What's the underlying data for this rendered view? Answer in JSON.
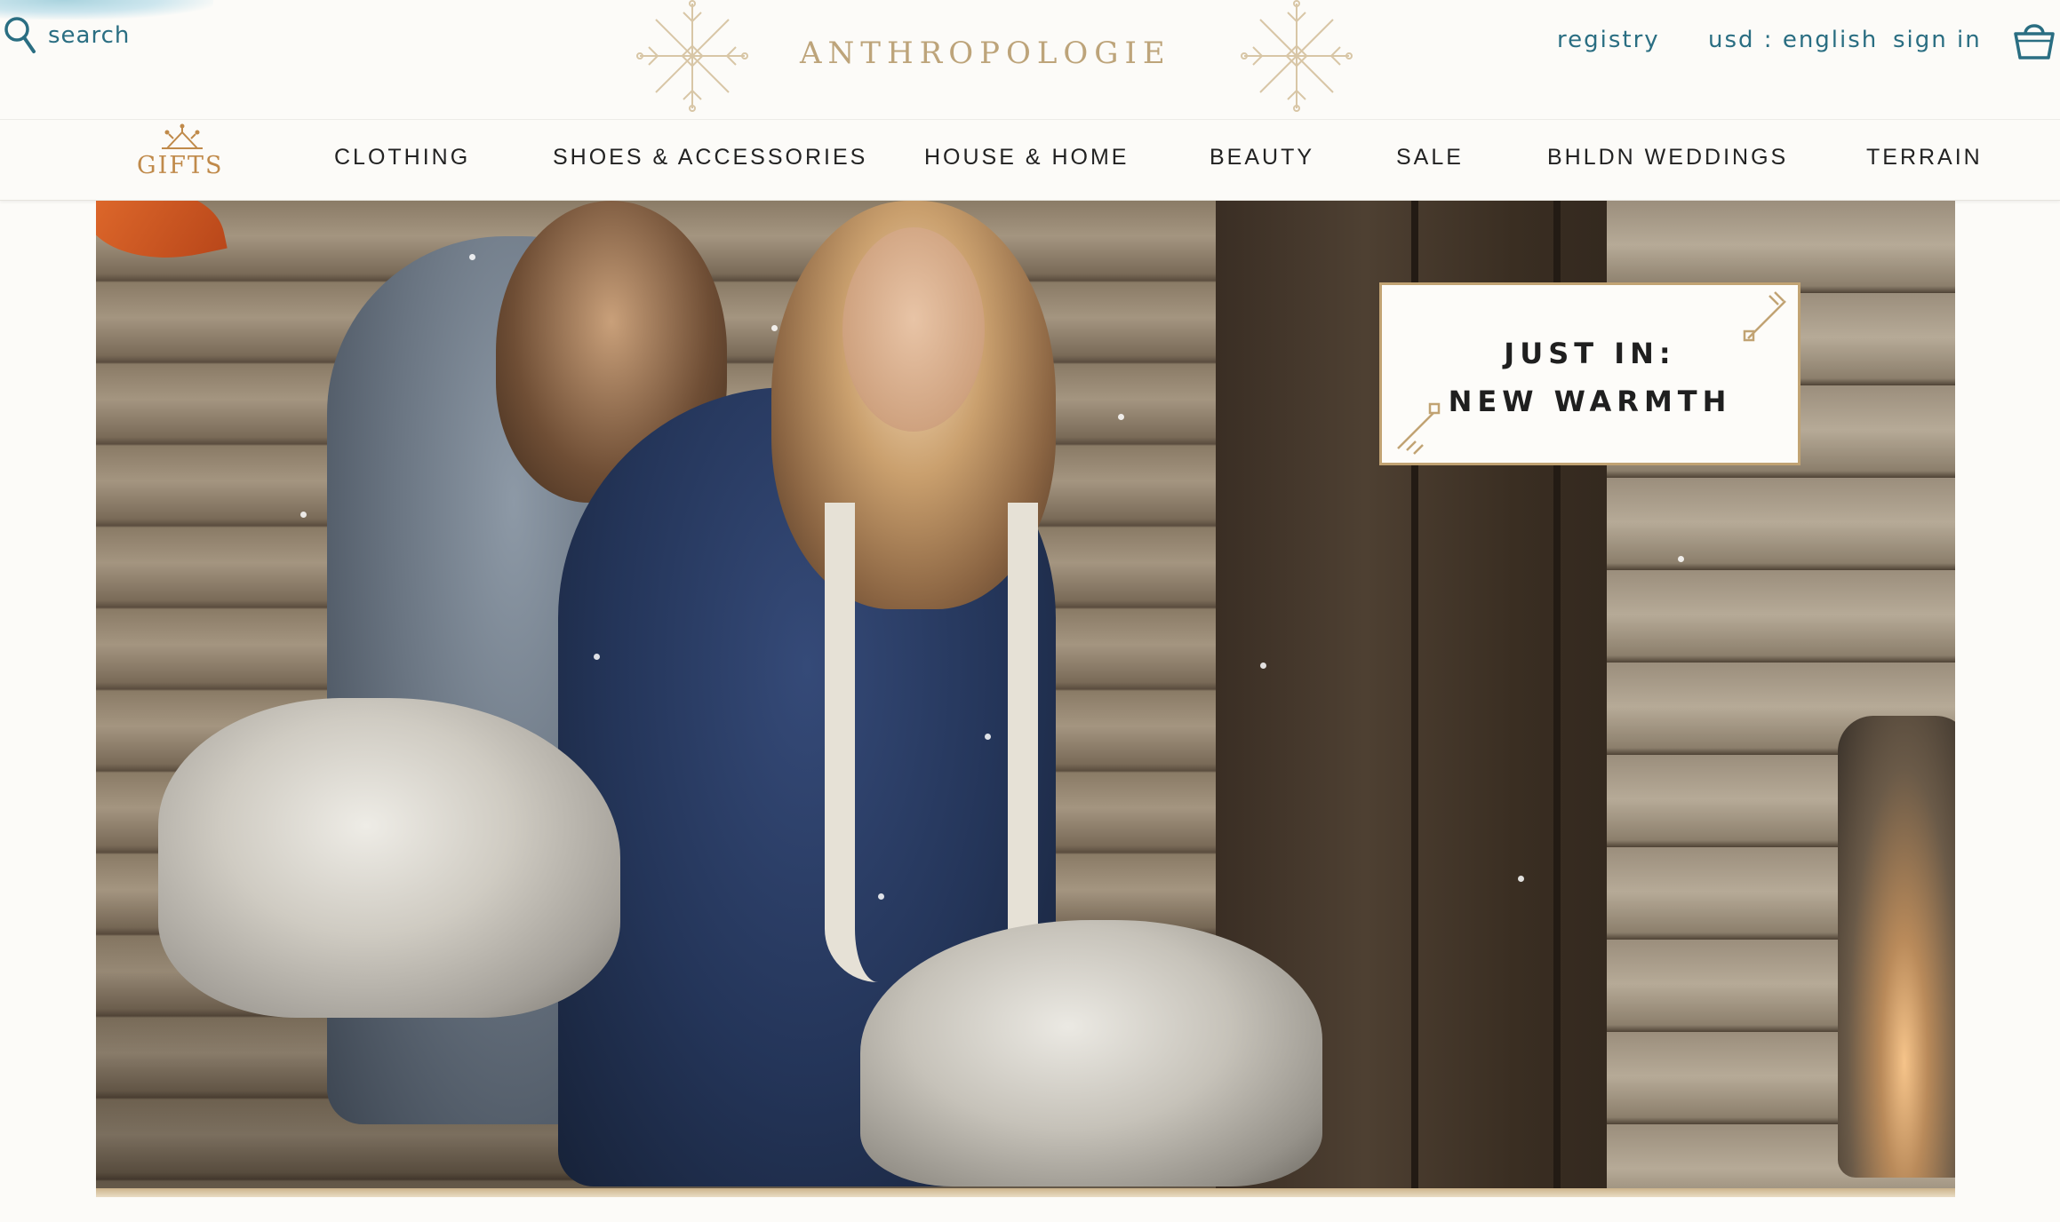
{
  "header": {
    "search_label": "search",
    "logo_text": "ANTHROPOLOGIE",
    "util_links": {
      "registry": "registry",
      "locale": "usd : english",
      "signin": "sign in"
    }
  },
  "nav": {
    "items": [
      "GIFTS",
      "CLOTHING",
      "SHOES & ACCESSORIES",
      "HOUSE & HOME",
      "BEAUTY",
      "SALE",
      "BHLDN WEDDINGS",
      "TERRAIN"
    ]
  },
  "hero": {
    "callout_line1": "JUST IN:",
    "callout_line2": "NEW WARMTH"
  },
  "colors": {
    "brand_teal": "#2a6e82",
    "gold": "#bda47a",
    "gifts_copper": "#c08a4a",
    "background": "#fcfbf8"
  },
  "icons": [
    "search-icon",
    "snowflake-ornament-icon",
    "shopping-bag-icon",
    "gifts-crown-icon"
  ]
}
